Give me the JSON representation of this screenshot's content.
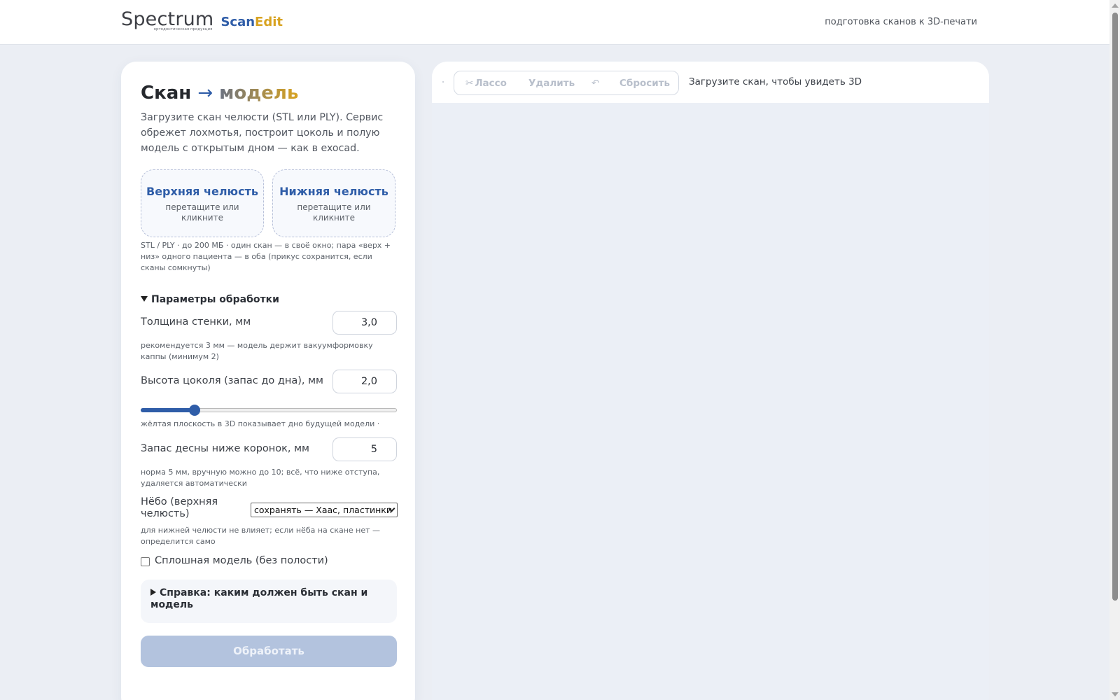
{
  "header": {
    "logo_word": "Spectrum",
    "logo_sub": "ортодонтическая продукция",
    "logo_scan": "Scan",
    "logo_edit": "Edit",
    "tagline": "подготовка сканов к 3D-печати"
  },
  "left": {
    "title_a": "Скан",
    "title_arrow": "→",
    "title_b": "модель",
    "intro": "Загрузите скан челюсти (STL или PLY). Сервис обрежет лохмотья, построит цоколь и полую модель с открытым дном — как в exocad.",
    "upper_title": "Верхняя челюсть",
    "upper_hint": "перетащите или кликните",
    "lower_title": "Нижняя челюсть",
    "lower_hint": "перетащите или кликните",
    "files_note": "STL / PLY · до 200 МБ · один скан — в своё окно; пара «верх + низ» одного пациента — в оба (прикус сохранится, если сканы сомкнуты)",
    "params_title": "Параметры обработки",
    "wall_label": "Толщина стенки, мм",
    "wall_value": "3,0",
    "wall_note": "рекомендуется 3 мм — модель держит вакуумформовку каппы (минимум 2)",
    "base_label": "Высота цоколя (запас до дна), мм",
    "base_value": "2,0",
    "base_slider_fraction": 0.21,
    "plane_note": "жёлтая плоскость в 3D показывает дно будущей модели ·",
    "gum_label": "Запас десны ниже коронок, мм",
    "gum_value": "5",
    "gum_note": "норма 5 мм, вручную можно до 10; всё, что ниже отступа, удаляется автоматически",
    "palate_label": "Нёбо (верхняя челюсть)",
    "palate_selected": "сохранять — Хаас, пластинки",
    "palate_note": "для нижней челюсти не влияет; если нёба на скане нет — определится само",
    "solid_label": "Сплошная модель (без полости)",
    "help_title": "Справка: каким должен быть скан и модель",
    "process_button": "Обработать"
  },
  "viewer": {
    "lasso": "Лассо",
    "lasso_icon": "scissors-icon",
    "delete": "Удалить",
    "undo_glyph": "↶",
    "reset": "Сбросить",
    "status": "Загрузите скан, чтобы увидеть 3D"
  },
  "colors": {
    "brand_blue": "#2f5da8",
    "brand_gold": "#d8a321",
    "page_bg": "#ebeef4"
  }
}
